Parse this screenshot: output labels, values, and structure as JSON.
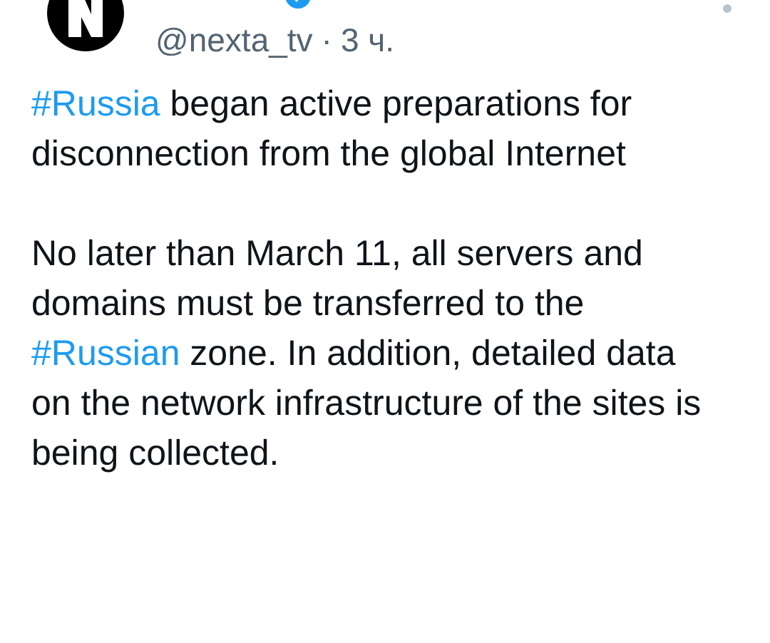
{
  "tweet": {
    "verified": true,
    "handle": "@nexta_tv",
    "separator": "·",
    "time": "3 ч.",
    "paragraphs": [
      [
        {
          "kind": "hashtag",
          "text": "#Russia"
        },
        {
          "kind": "text",
          "text": " began active preparations for disconnection from the global Internet"
        }
      ],
      [
        {
          "kind": "text",
          "text": "No later than March 11, all servers and domains must be transferred to the "
        },
        {
          "kind": "hashtag",
          "text": "#Russian"
        },
        {
          "kind": "text",
          "text": " zone. In addition, detailed data on the network infrastructure of the sites is being collected."
        }
      ]
    ]
  }
}
